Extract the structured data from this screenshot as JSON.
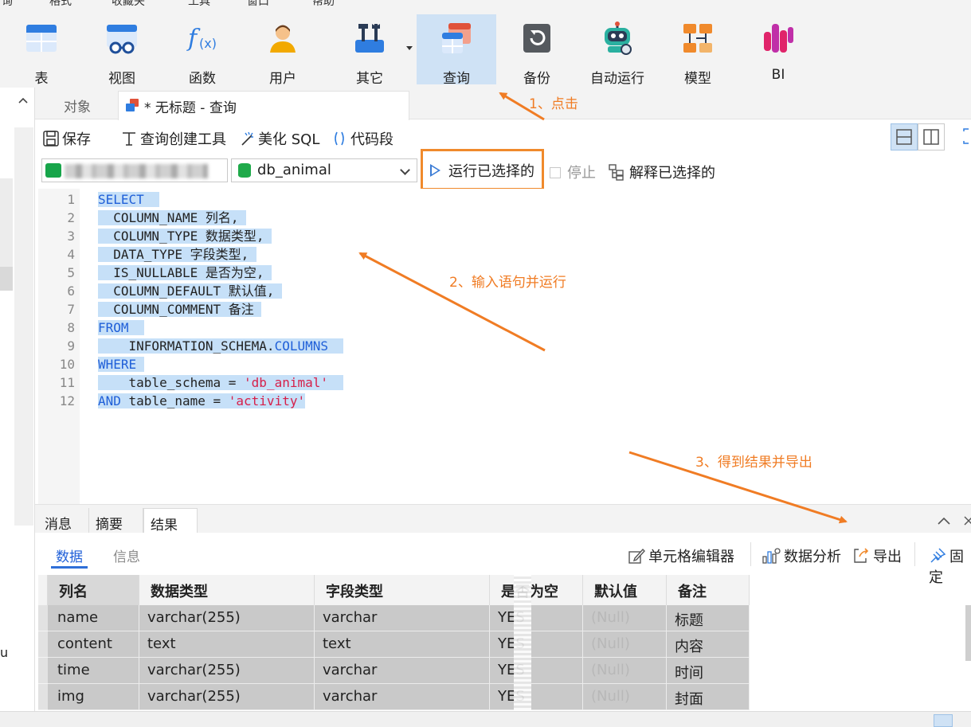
{
  "menu": {
    "items": [
      "询",
      "格式",
      "收藏夹",
      "工具",
      "窗口",
      "帮助"
    ]
  },
  "ribbon": {
    "buttons": [
      {
        "label": "表"
      },
      {
        "label": "视图"
      },
      {
        "label": "函数"
      },
      {
        "label": "用户"
      },
      {
        "label": "其它"
      },
      {
        "label": "查询"
      },
      {
        "label": "备份"
      },
      {
        "label": "自动运行"
      },
      {
        "label": "模型"
      },
      {
        "label": "BI"
      }
    ],
    "active_index": 5
  },
  "tabs": {
    "objects": "对象",
    "query_tab": "* 无标题 - 查询"
  },
  "toolbar": {
    "save": "保存",
    "query_builder": "查询创建工具",
    "beautify": "美化 SQL",
    "snippet": "代码段"
  },
  "connection_bar": {
    "database": "db_animal",
    "run_selected": "运行已选择的",
    "stop": "停止",
    "explain_selected": "解释已选择的"
  },
  "editor": {
    "line_numbers": [
      "1",
      "2",
      "3",
      "4",
      "5",
      "6",
      "7",
      "8",
      "9",
      "10",
      "11",
      "12"
    ]
  },
  "result_tabs": {
    "messages": "消息",
    "summary": "摘要",
    "result1": "结果 1"
  },
  "result_subtabs": {
    "data": "数据",
    "info": "信息"
  },
  "result_tools": {
    "cell_editor": "单元格编辑器",
    "data_analysis": "数据分析",
    "export": "导出",
    "pin": "固定"
  },
  "grid": {
    "headers": [
      "列名",
      "数据类型",
      "字段类型",
      "是否为空",
      "默认值",
      "备注"
    ],
    "rows": [
      [
        "name",
        "varchar(255)",
        "varchar",
        "YES",
        "(Null)",
        "标题"
      ],
      [
        "content",
        "text",
        "text",
        "YES",
        "(Null)",
        "内容"
      ],
      [
        "time",
        "varchar(255)",
        "varchar",
        "YES",
        "(Null)",
        "时间"
      ],
      [
        "img",
        "varchar(255)",
        "varchar",
        "YES",
        "(Null)",
        "封面"
      ]
    ]
  },
  "left_strip": {
    "partial_text": "u"
  },
  "annotations": {
    "step1": "1、点击",
    "step2": "2、输入语句并运行",
    "step3": "3、得到结果并导出",
    "color": "#f07c24"
  }
}
